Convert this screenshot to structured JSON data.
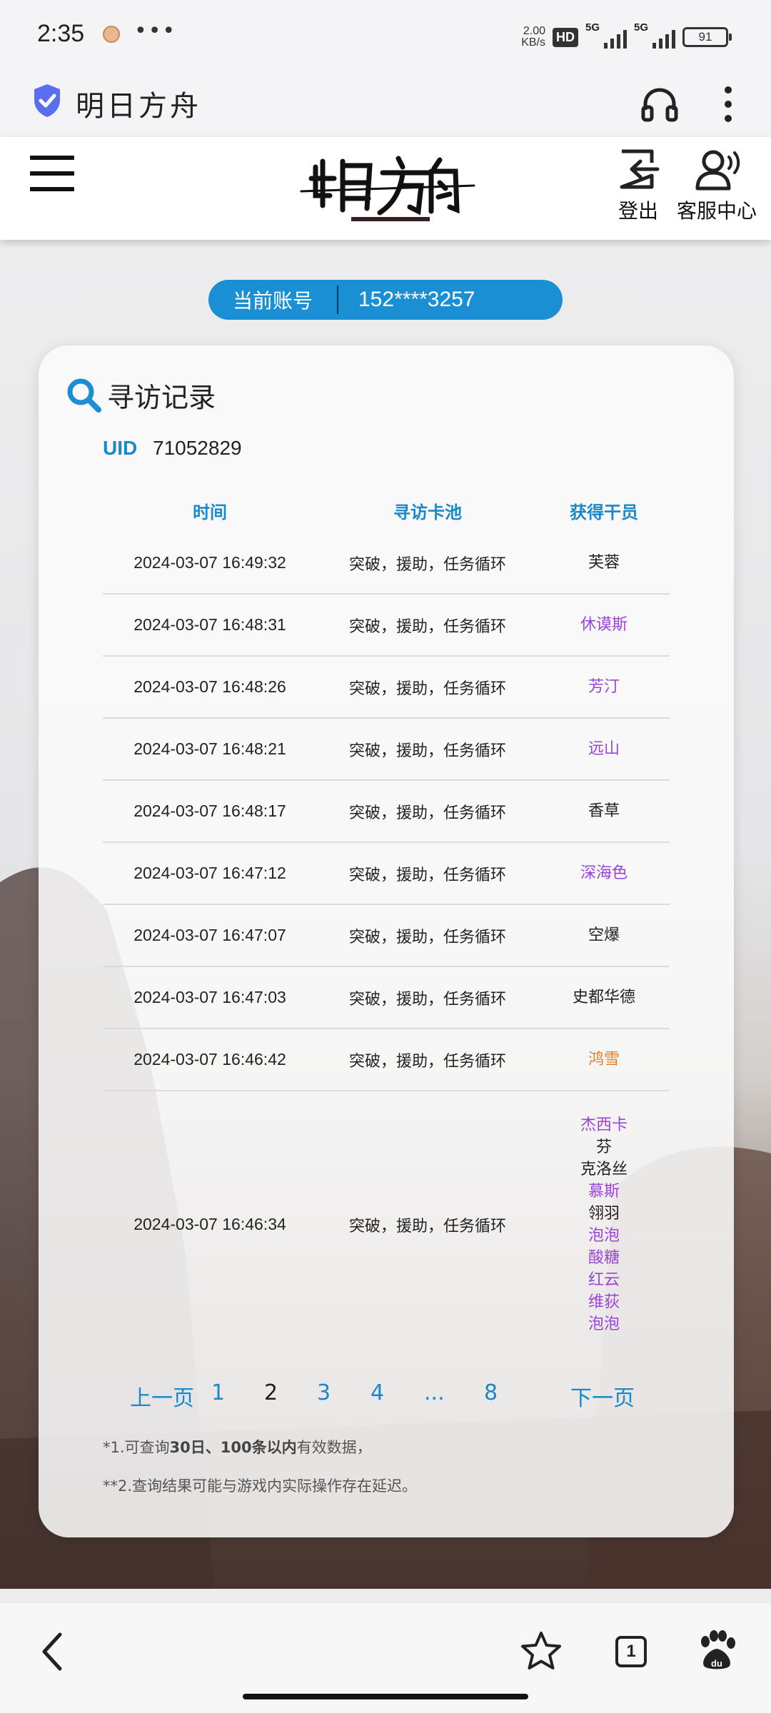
{
  "status_bar": {
    "time": "2:35",
    "net_speed_value": "2.00",
    "net_speed_unit": "KB/s",
    "hd_label": "HD",
    "signal1": "5G",
    "signal2": "5G",
    "battery": "91"
  },
  "app_bar": {
    "title": "明日方舟"
  },
  "header": {
    "logout_label": "登出",
    "service_label": "客服中心"
  },
  "account": {
    "label": "当前账号",
    "value": "152****3257"
  },
  "card": {
    "title": "寻访记录",
    "uid_label": "UID",
    "uid_value": "71052829",
    "columns": [
      "时间",
      "寻访卡池",
      "获得干员"
    ],
    "rows": [
      {
        "time": "2024-03-07 16:49:32",
        "pool": "突破，援助，任务循环",
        "operators": [
          {
            "name": "芙蓉",
            "rarity": 3
          }
        ]
      },
      {
        "time": "2024-03-07 16:48:31",
        "pool": "突破，援助，任务循环",
        "operators": [
          {
            "name": "休谟斯",
            "rarity": 4
          }
        ]
      },
      {
        "time": "2024-03-07 16:48:26",
        "pool": "突破，援助，任务循环",
        "operators": [
          {
            "name": "芳汀",
            "rarity": 4
          }
        ]
      },
      {
        "time": "2024-03-07 16:48:21",
        "pool": "突破，援助，任务循环",
        "operators": [
          {
            "name": "远山",
            "rarity": 4
          }
        ]
      },
      {
        "time": "2024-03-07 16:48:17",
        "pool": "突破，援助，任务循环",
        "operators": [
          {
            "name": "香草",
            "rarity": 3
          }
        ]
      },
      {
        "time": "2024-03-07 16:47:12",
        "pool": "突破，援助，任务循环",
        "operators": [
          {
            "name": "深海色",
            "rarity": 4
          }
        ]
      },
      {
        "time": "2024-03-07 16:47:07",
        "pool": "突破，援助，任务循环",
        "operators": [
          {
            "name": "空爆",
            "rarity": 3
          }
        ]
      },
      {
        "time": "2024-03-07 16:47:03",
        "pool": "突破，援助，任务循环",
        "operators": [
          {
            "name": "史都华德",
            "rarity": 3
          }
        ]
      },
      {
        "time": "2024-03-07 16:46:42",
        "pool": "突破，援助，任务循环",
        "operators": [
          {
            "name": "鸿雪",
            "rarity": 5
          }
        ]
      },
      {
        "time": "2024-03-07 16:46:34",
        "pool": "突破，援助，任务循环",
        "operators": [
          {
            "name": "杰西卡",
            "rarity": 4
          },
          {
            "name": "芬",
            "rarity": 3
          },
          {
            "name": "克洛丝",
            "rarity": 3
          },
          {
            "name": "慕斯",
            "rarity": 4
          },
          {
            "name": "翎羽",
            "rarity": 3
          },
          {
            "name": "泡泡",
            "rarity": 4
          },
          {
            "name": "酸糖",
            "rarity": 4
          },
          {
            "name": "红云",
            "rarity": 4
          },
          {
            "name": "维荻",
            "rarity": 4
          },
          {
            "name": "泡泡",
            "rarity": 4
          }
        ]
      }
    ],
    "pagination": {
      "prev": "上一页",
      "pages": [
        "1",
        "2",
        "3",
        "4",
        "...",
        "8"
      ],
      "current": "2",
      "next": "下一页"
    },
    "notes": {
      "note1_a": "*1.可查询",
      "note1_b": "30日、100条以内",
      "note1_c": "有效数据，",
      "note2": "**2.查询结果可能与游戏内实际操作存在延迟。"
    }
  },
  "bottom_nav": {
    "tab_count": "1",
    "icons": [
      "back-icon",
      "star-icon",
      "tabs-icon",
      "baidu-icon"
    ]
  },
  "colors": {
    "accent_blue": "#1b8fd3",
    "rarity3": "#222222",
    "rarity4": "#9a44d8",
    "rarity5": "#e07f2a"
  }
}
